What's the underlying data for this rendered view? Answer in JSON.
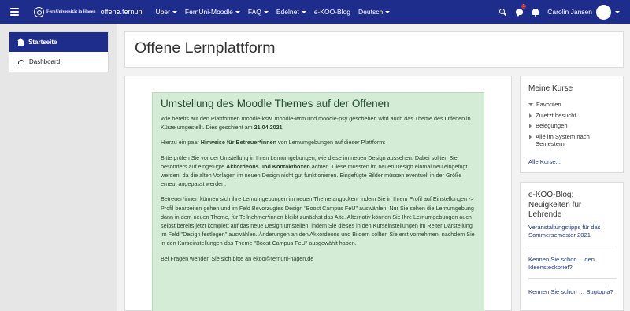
{
  "navbar": {
    "logo_text": "FernUniversität in Hagen",
    "site_name": "offene.fernuni",
    "menus": [
      "Über",
      "FernUni-Moodle",
      "FAQ",
      "Edelnet",
      "e-KOO-Blog",
      "Deutsch"
    ],
    "menu_has_caret": [
      true,
      true,
      true,
      true,
      false,
      true
    ],
    "message_badge": "1",
    "user_name": "Carolin Jansen"
  },
  "drawer": {
    "items": [
      {
        "label": "Startseite",
        "icon": "home-icon",
        "active": true
      },
      {
        "label": "Dashboard",
        "icon": "dashboard-icon",
        "active": false
      }
    ]
  },
  "page": {
    "title": "Offene Lernplattform"
  },
  "notice": {
    "title": "Umstellung des Moodle Themes auf der Offenen",
    "p1_text": "Wie bereits auf den Plattformen moodle-ksw, moodle-wrm und moodle-psy geschehen wird auch das Theme des Offenen in Kürze umgestellt. Dies geschieht am ",
    "p1_date": "21.04.2021",
    "p1_end": ".",
    "p2_text": "Hierzu ein paar ",
    "p2_bold": "Hinweise für Betreuer*innen",
    "p2_end": " von Lernumgebungen auf dieser Plattform:",
    "p3_text": "Bitte prüfen Sie vor der Umstellung in Ihren Lernumgebungen, wie diese im neuen Design aussehen. Dabei sollten Sie besonders auf eingefügte ",
    "p3_bold": "Akkordeons und Kontaktboxen",
    "p3_end": " achten. Diese müssten im neuen Design einmal neu eingefügt werden, da die alten Vorlagen im neuen Design nicht gut funktionieren. Eingefügte Bilder müssen eventuell in der Größe erneut angepasst werden.",
    "p4": "Betreuer*innen können sich ihre Lernumgebungen im neuen Theme angucken, indem Sie in Ihrem Profil auf Einstellungen -> Profil bearbeiten gehen und im Feld Bevorzugtes Design \"Boost Campus FeU\" auswählen. Nur Sie sehen die Lernumgebung dann in dem neuen Theme, für Teilnehmer*innen bleibt zunächst das Alte. Alternativ können Sie Ihre Lernumgebungen auch selbst bereits jetzt komplett auf das neue Design umstellen, indem Sie dieses in den Kurseinstellungen im Reiter Darstellung im Feld \"Design festlegen\" auswählen. Änderungen an den Akkordeons und Bildern sollten Sie erst vornehmen, nachdem Sie in den Kurseinstellungen das Theme \"Boost Campus FeU\" ausgewählt haben.",
    "p5": "Bei Fragen wenden Sie sich bitte an ekoo@fernuni-hagen.de"
  },
  "my_courses": {
    "title": "Meine Kurse",
    "items": [
      {
        "label": "Favoriten",
        "expanded": true
      },
      {
        "label": "Zuletzt besucht",
        "expanded": false
      },
      {
        "label": "Belegungen",
        "expanded": false
      },
      {
        "label": "Alle im System nach Semestern",
        "expanded": false
      }
    ],
    "all_link": "Alle Kurse..."
  },
  "blog": {
    "title": "e-KOO-Blog: Neuigkeiten für Lehrende",
    "entries": [
      "Veranstaltungstipps für das Sommersemester 2021",
      "Kennen Sie schon… den Ideensteckbrief?",
      "Kennen Sie schon … Bugtopia?"
    ]
  },
  "colors": {
    "navbar": "#1e2c8c",
    "notice_bg": "#d4ecd6",
    "link": "#1e3a8a"
  }
}
